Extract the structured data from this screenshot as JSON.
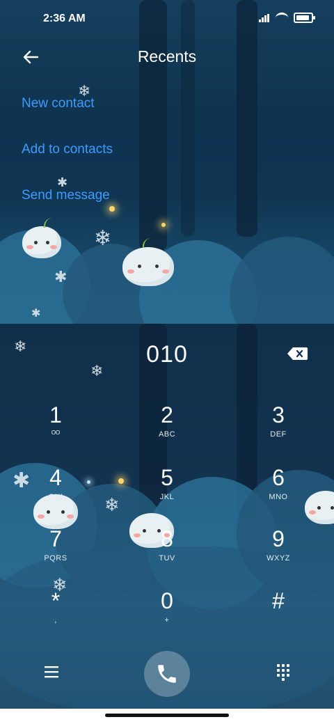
{
  "status_bar": {
    "time": "2:36 AM",
    "battery_level": 0.9
  },
  "header": {
    "title": "Recents",
    "back_icon": "back-arrow-icon"
  },
  "options": [
    {
      "label": "New contact"
    },
    {
      "label": "Add to contacts"
    },
    {
      "label": "Send message"
    }
  ],
  "dialer": {
    "number": "010",
    "keys": [
      {
        "digit": "1",
        "letters": ""
      },
      {
        "digit": "2",
        "letters": "ABC"
      },
      {
        "digit": "3",
        "letters": "DEF"
      },
      {
        "digit": "4",
        "letters": "GHI"
      },
      {
        "digit": "5",
        "letters": "JKL"
      },
      {
        "digit": "6",
        "letters": "MNO"
      },
      {
        "digit": "7",
        "letters": "PQRS"
      },
      {
        "digit": "8",
        "letters": "TUV"
      },
      {
        "digit": "9",
        "letters": "WXYZ"
      },
      {
        "digit": "*",
        "letters": ","
      },
      {
        "digit": "0",
        "letters": "+"
      },
      {
        "digit": "#",
        "letters": ""
      }
    ]
  },
  "bottom_bar": {
    "menu_icon": "hamburger-menu-icon",
    "call_icon": "phone-icon",
    "keypad_icon": "dialpad-icon"
  },
  "colors": {
    "link": "#3f9bff",
    "background": "#0f2f4a"
  }
}
